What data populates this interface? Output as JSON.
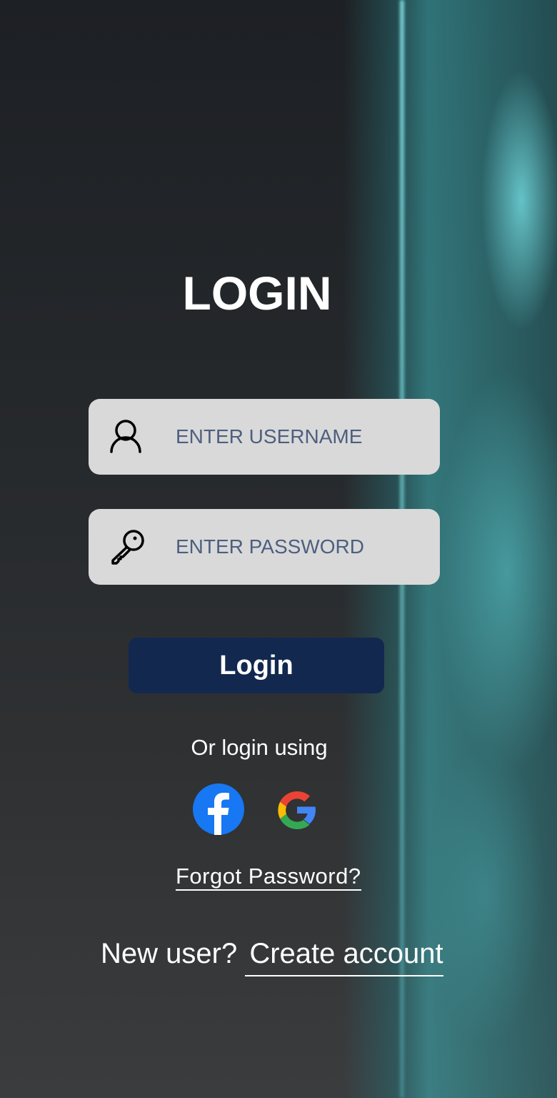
{
  "title": "LOGIN",
  "username": {
    "placeholder": "ENTER USERNAME",
    "value": ""
  },
  "password": {
    "placeholder": "ENTER PASSWORD",
    "value": ""
  },
  "login_button": "Login",
  "or_text": "Or login using",
  "social": [
    {
      "icon": "facebook-icon",
      "color": "#1877f2"
    },
    {
      "icon": "google-icon"
    }
  ],
  "forgot_password": "Forgot Password?",
  "new_user": "New user?",
  "create_account": "Create account"
}
